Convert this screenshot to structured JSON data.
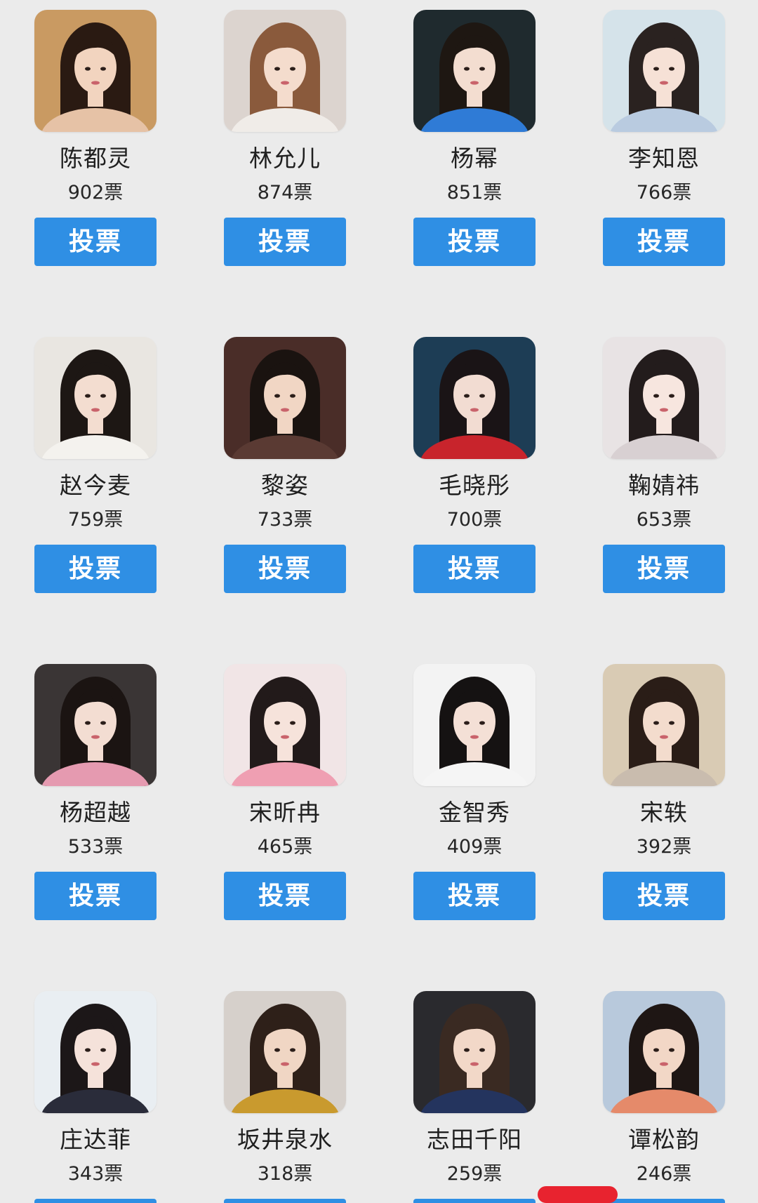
{
  "vote_label": "投票",
  "cards": [
    {
      "name": "陈都灵",
      "votes": "902票",
      "bg": "#c99a62",
      "hair": "#2a1a12",
      "skin": "#f2d4bf",
      "top": "#e6c2a6"
    },
    {
      "name": "林允儿",
      "votes": "874票",
      "bg": "#dcd4cf",
      "hair": "#8a5a3c",
      "skin": "#f4dccd",
      "top": "#f0ece8"
    },
    {
      "name": "杨幂",
      "votes": "851票",
      "bg": "#1f2a2e",
      "hair": "#1e1712",
      "skin": "#f3ddd0",
      "top": "#2f7bd6"
    },
    {
      "name": "李知恩",
      "votes": "766票",
      "bg": "#d5e3ea",
      "hair": "#2a2220",
      "skin": "#f6e1d6",
      "top": "#b9cbe0"
    },
    {
      "name": "赵今麦",
      "votes": "759票",
      "bg": "#e9e6e1",
      "hair": "#1d1714",
      "skin": "#f3ddd0",
      "top": "#f4f2ee"
    },
    {
      "name": "黎姿",
      "votes": "733票",
      "bg": "#4a2d28",
      "hair": "#1a1310",
      "skin": "#f1d6c4",
      "top": "#5a3a33"
    },
    {
      "name": "毛晓彤",
      "votes": "700票",
      "bg": "#1d3d55",
      "hair": "#1a1416",
      "skin": "#f2dcd2",
      "top": "#c8242c"
    },
    {
      "name": "鞠婧祎",
      "votes": "653票",
      "bg": "#e8e3e4",
      "hair": "#231c1c",
      "skin": "#f7e6df",
      "top": "#d8d0d2"
    },
    {
      "name": "杨超越",
      "votes": "533票",
      "bg": "#3a3535",
      "hair": "#1b1412",
      "skin": "#f3ddd2",
      "top": "#e59ab0"
    },
    {
      "name": "宋昕冉",
      "votes": "465票",
      "bg": "#f1e5e6",
      "hair": "#221a1a",
      "skin": "#f6e3db",
      "top": "#ef9fb2"
    },
    {
      "name": "金智秀",
      "votes": "409票",
      "bg": "#f3f3f3",
      "hair": "#151212",
      "skin": "#f4e0d6",
      "top": "#f5f5f5"
    },
    {
      "name": "宋轶",
      "votes": "392票",
      "bg": "#d9cbb4",
      "hair": "#2a1d17",
      "skin": "#f3dccd",
      "top": "#c9bcae"
    },
    {
      "name": "庄达菲",
      "votes": "343票",
      "bg": "#e9eef2",
      "hair": "#1c1718",
      "skin": "#f5e2da",
      "top": "#2a2c3a"
    },
    {
      "name": "坂井泉水",
      "votes": "318票",
      "bg": "#d6d0cb",
      "hair": "#2e2019",
      "skin": "#f0d6c4",
      "top": "#c99a2e"
    },
    {
      "name": "志田千阳",
      "votes": "259票",
      "bg": "#2a2a2e",
      "hair": "#3a2a22",
      "skin": "#f2d8c8",
      "top": "#24345e"
    },
    {
      "name": "谭松韵",
      "votes": "246票",
      "bg": "#b8c9dc",
      "hair": "#1e1614",
      "skin": "#f2d7c6",
      "top": "#e58a6a"
    }
  ]
}
